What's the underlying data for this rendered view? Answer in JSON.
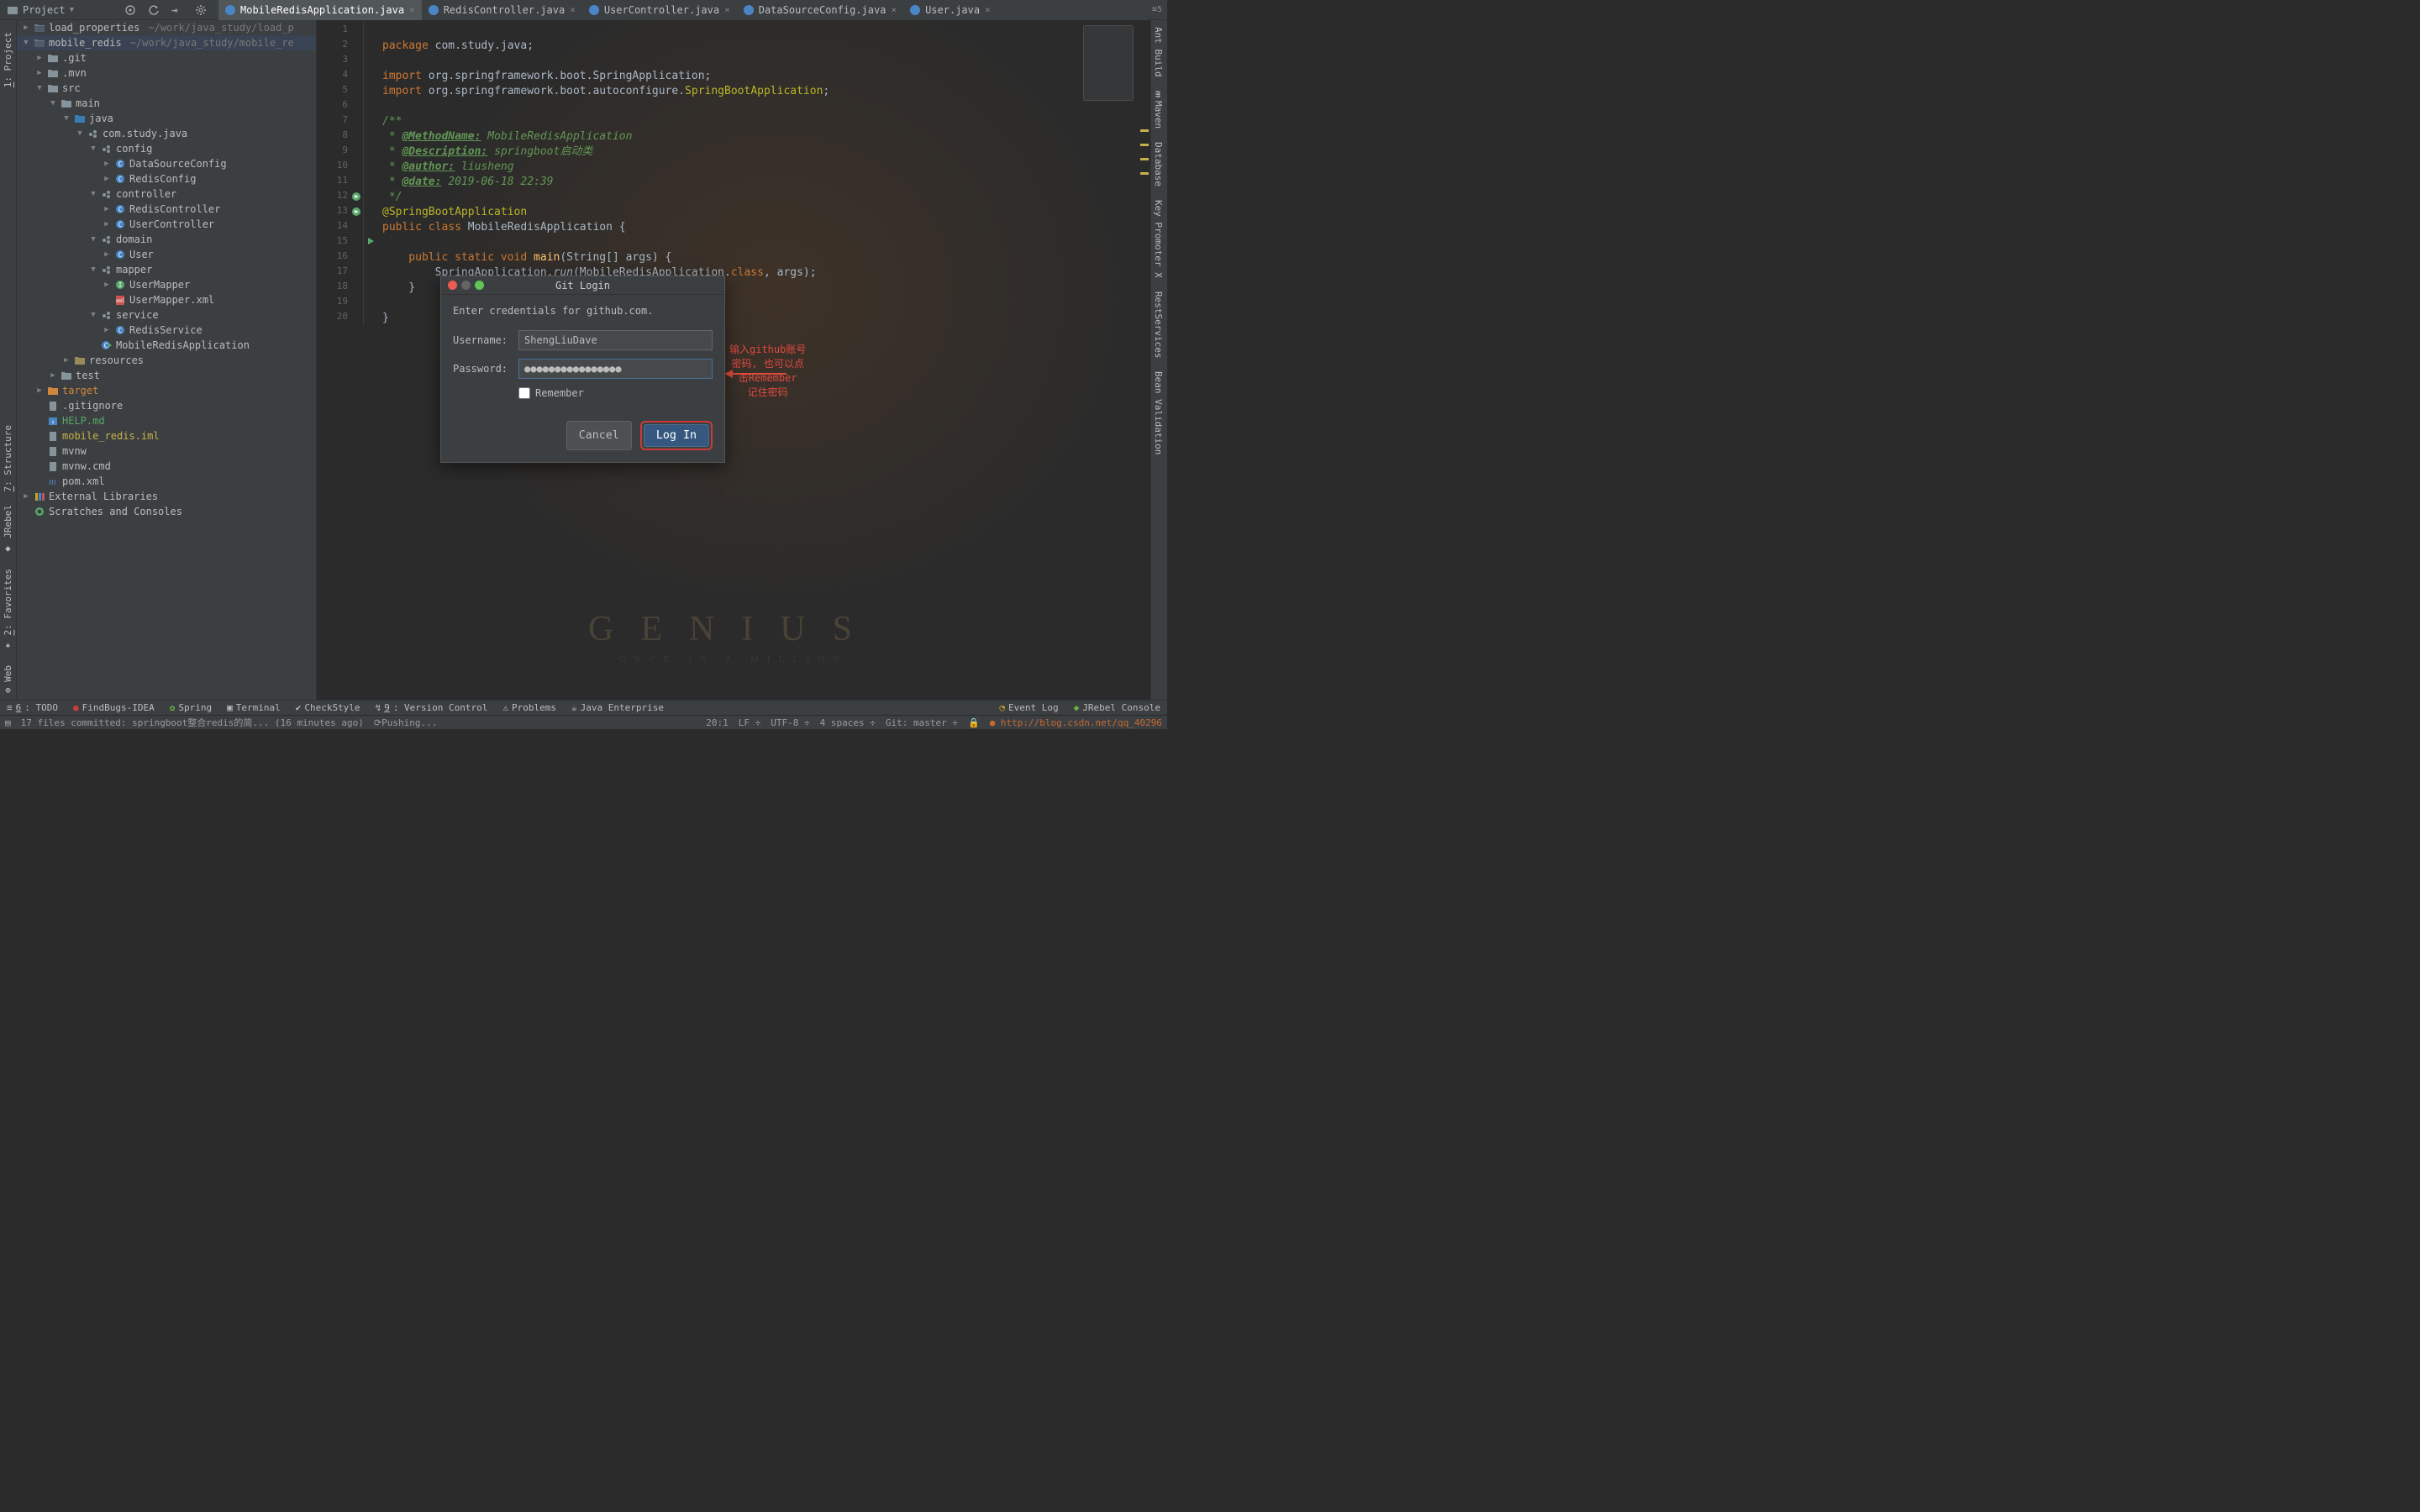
{
  "header": {
    "project_label": "Project",
    "icons": [
      "target-icon",
      "refresh-icon",
      "collapse-icon",
      "gear-icon"
    ]
  },
  "editor_tabs": [
    {
      "name": "MobileRedisApplication.java",
      "active": true
    },
    {
      "name": "RedisController.java",
      "active": false
    },
    {
      "name": "UserController.java",
      "active": false
    },
    {
      "name": "DataSourceConfig.java",
      "active": false
    },
    {
      "name": "User.java",
      "active": false
    }
  ],
  "left_tools": [
    {
      "label": "1: Project",
      "u": "1"
    },
    {
      "label": "7: Structure",
      "u": "7"
    },
    {
      "label": "JRebel"
    },
    {
      "label": "2: Favorites",
      "u": "2"
    },
    {
      "label": "Web"
    }
  ],
  "right_tools": [
    {
      "label": "Ant Build"
    },
    {
      "label": "Maven"
    },
    {
      "label": "Database"
    },
    {
      "label": "Key Promoter X"
    },
    {
      "label": "RestServices"
    },
    {
      "label": "Bean Validation"
    }
  ],
  "tree": [
    {
      "indent": 0,
      "arw": "▶",
      "icon": "folder-dk",
      "label": "load_properties",
      "dim": "~/work/java_study/load_p"
    },
    {
      "indent": 0,
      "arw": "▼",
      "icon": "folder-dk",
      "label": "mobile_redis",
      "dim": "~/work/java_study/mobile_re",
      "sel": true
    },
    {
      "indent": 1,
      "arw": "▶",
      "icon": "folder",
      "label": ".git"
    },
    {
      "indent": 1,
      "arw": "▶",
      "icon": "folder",
      "label": ".mvn"
    },
    {
      "indent": 1,
      "arw": "▼",
      "icon": "folder",
      "label": "src"
    },
    {
      "indent": 2,
      "arw": "▼",
      "icon": "folder",
      "label": "main"
    },
    {
      "indent": 3,
      "arw": "▼",
      "icon": "folder-src",
      "label": "java"
    },
    {
      "indent": 4,
      "arw": "▼",
      "icon": "pkg",
      "label": "com.study.java"
    },
    {
      "indent": 5,
      "arw": "▼",
      "icon": "pkg",
      "label": "config"
    },
    {
      "indent": 6,
      "arw": "▶",
      "icon": "class",
      "label": "DataSourceConfig"
    },
    {
      "indent": 6,
      "arw": "▶",
      "icon": "class",
      "label": "RedisConfig"
    },
    {
      "indent": 5,
      "arw": "▼",
      "icon": "pkg",
      "label": "controller"
    },
    {
      "indent": 6,
      "arw": "▶",
      "icon": "class",
      "label": "RedisController"
    },
    {
      "indent": 6,
      "arw": "▶",
      "icon": "class",
      "label": "UserController"
    },
    {
      "indent": 5,
      "arw": "▼",
      "icon": "pkg",
      "label": "domain"
    },
    {
      "indent": 6,
      "arw": "▶",
      "icon": "class",
      "label": "User"
    },
    {
      "indent": 5,
      "arw": "▼",
      "icon": "pkg",
      "label": "mapper"
    },
    {
      "indent": 6,
      "arw": "▶",
      "icon": "iface",
      "label": "UserMapper"
    },
    {
      "indent": 6,
      "arw": "",
      "icon": "xml",
      "label": "UserMapper.xml"
    },
    {
      "indent": 5,
      "arw": "▼",
      "icon": "pkg",
      "label": "service"
    },
    {
      "indent": 6,
      "arw": "▶",
      "icon": "class",
      "label": "RedisService"
    },
    {
      "indent": 5,
      "arw": "",
      "icon": "class-run",
      "label": "MobileRedisApplication"
    },
    {
      "indent": 3,
      "arw": "▶",
      "icon": "folder-res",
      "label": "resources"
    },
    {
      "indent": 2,
      "arw": "▶",
      "icon": "folder",
      "label": "test"
    },
    {
      "indent": 1,
      "arw": "▶",
      "icon": "folder-target",
      "label": "target"
    },
    {
      "indent": 1,
      "arw": "",
      "icon": "file",
      "label": ".gitignore"
    },
    {
      "indent": 1,
      "arw": "",
      "icon": "md",
      "label": "HELP.md"
    },
    {
      "indent": 1,
      "arw": "",
      "icon": "file",
      "label": "mobile_redis.iml",
      "color": "#c9b04a"
    },
    {
      "indent": 1,
      "arw": "",
      "icon": "file",
      "label": "mvnw"
    },
    {
      "indent": 1,
      "arw": "",
      "icon": "file",
      "label": "mvnw.cmd"
    },
    {
      "indent": 1,
      "arw": "",
      "icon": "maven",
      "label": "pom.xml"
    },
    {
      "indent": 0,
      "arw": "▶",
      "icon": "lib",
      "label": "External Libraries"
    },
    {
      "indent": 0,
      "arw": "",
      "icon": "scratch",
      "label": "Scratches and Consoles"
    }
  ],
  "code": {
    "lines": 20,
    "l1": "package com.study.java;",
    "l3": "import org.springframework.boot.SpringApplication;",
    "l4a": "import org.springframework.boot.autoconfigure.",
    "l4b": "SpringBootApplication",
    "l4c": ";",
    "l6": "/**",
    "l7a": " * ",
    "l7b": "@MethodName:",
    "l7c": " MobileRedisApplication",
    "l8a": " * ",
    "l8b": "@Description:",
    "l8c": " springboot启动类",
    "l9a": " * ",
    "l9b": "@author:",
    "l9c": " liusheng",
    "l10a": " * ",
    "l10b": "@date:",
    "l10c": " 2019-06-18 22:39",
    "l11": " */",
    "l12": "@SpringBootApplication",
    "l13a": "public class ",
    "l13b": "MobileRedisApplication",
    "l13c": " {",
    "l15a": "    public static void ",
    "l15b": "main",
    "l15c": "(String[] args) {",
    "l16a": "        SpringApplication.",
    "l16b": "run",
    "l16c": "(MobileRedisApplication.",
    "l16d": "class",
    "l16e": ", args);",
    "l17": "    }",
    "l19": "}"
  },
  "dialog": {
    "title": "Git Login",
    "message": "Enter credentials for github.com.",
    "username_label": "Username:",
    "username_value": "ShengLiuDave",
    "password_label": "Password:",
    "password_value": "●●●●●●●●●●●●●●●●",
    "remember_label": "Remember",
    "cancel": "Cancel",
    "login": "Log In"
  },
  "annotation": {
    "l1": "输入github账号",
    "l2": "密码, 也可以点",
    "l3": "击Remember",
    "l4": "记住密码"
  },
  "bottom": {
    "todo": "6: TODO",
    "findbugs": "FindBugs-IDEA",
    "spring": "Spring",
    "terminal": "Terminal",
    "checkstyle": "CheckStyle",
    "vcs": "9: Version Control",
    "problems": "Problems",
    "javaee": "Java Enterprise",
    "eventlog": "Event Log",
    "jrebel": "JRebel Console"
  },
  "status": {
    "commit": "17 files committed: springboot整合redis的简... (16 minutes ago)",
    "pushing": "Pushing...",
    "pos": "20:1",
    "lf": "LF",
    "enc": "UTF-8",
    "indent": "4 spaces",
    "git": "Git: master"
  },
  "bg": {
    "genius": "GENIUS",
    "sub": "ONCE IN A MILLION"
  }
}
